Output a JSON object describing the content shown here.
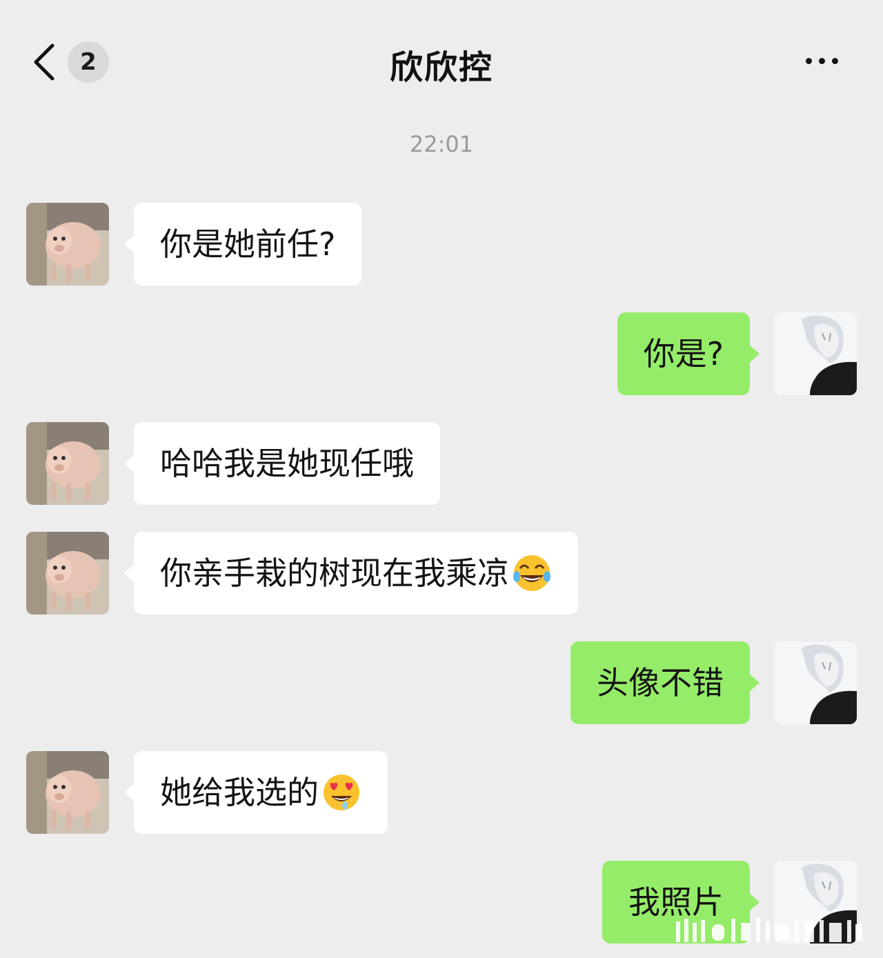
{
  "header": {
    "back_icon": "chevron-left-icon",
    "unread_count": "2",
    "title": "欣欣控",
    "more_icon": "ellipsis-icon"
  },
  "chat": {
    "timestamp": "22:01",
    "messages": [
      {
        "side": "in",
        "text": "你是她前任?",
        "emoji": ""
      },
      {
        "side": "out",
        "text": "你是?",
        "emoji": ""
      },
      {
        "side": "in",
        "text": "哈哈我是她现任哦",
        "emoji": ""
      },
      {
        "side": "in",
        "text": "你亲手栽的树现在我乘凉",
        "emoji": "tears-of-joy-emoji"
      },
      {
        "side": "out",
        "text": "头像不错",
        "emoji": ""
      },
      {
        "side": "in",
        "text": "她给我选的",
        "emoji": "heart-eyes-emoji"
      },
      {
        "side": "out",
        "text": "我照片",
        "emoji": ""
      }
    ]
  },
  "colors": {
    "background": "#ededed",
    "incoming_bubble": "#ffffff",
    "outgoing_bubble": "#95ec69"
  }
}
